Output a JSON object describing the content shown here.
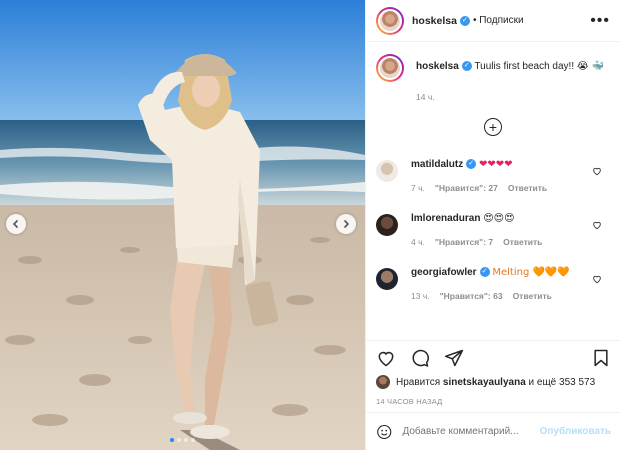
{
  "post": {
    "username": "hoskelsa",
    "follow_label": "Подписки",
    "more": "•••",
    "caption": "Tuulis first beach day!!",
    "caption_emoji": "😭 🐳",
    "caption_time": "14 ч."
  },
  "comments": [
    {
      "user": "matildalutz",
      "verified": true,
      "text": "❤❤❤❤",
      "time": "7 ч.",
      "likes": "\"Нравится\": 27",
      "reply": "Ответить"
    },
    {
      "user": "lmlorenaduran",
      "verified": false,
      "text": "😍😍😍",
      "time": "4 ч.",
      "likes": "\"Нравится\": 7",
      "reply": "Ответить"
    },
    {
      "user": "georgiafowler",
      "verified": true,
      "text": "Melting 🧡🧡🧡",
      "time": "13 ч.",
      "likes": "\"Нравится\": 63",
      "reply": "Ответить"
    }
  ],
  "likes_prefix": "Нравится",
  "likes_user": "sinetskayaulyana",
  "likes_suffix": "и ещё 353 573",
  "time_ago": "14 ЧАСОВ НАЗАД",
  "add_comment_placeholder": "Добавьте комментарий...",
  "publish_label": "Опубликовать",
  "carousel": {
    "count": 4,
    "active": 0
  },
  "colors": {
    "accent": "#3897f0",
    "heart": "#e0245e",
    "publish": "#b2dffc",
    "sky": "#3b8ee0",
    "sand": "#d8c8b6"
  }
}
